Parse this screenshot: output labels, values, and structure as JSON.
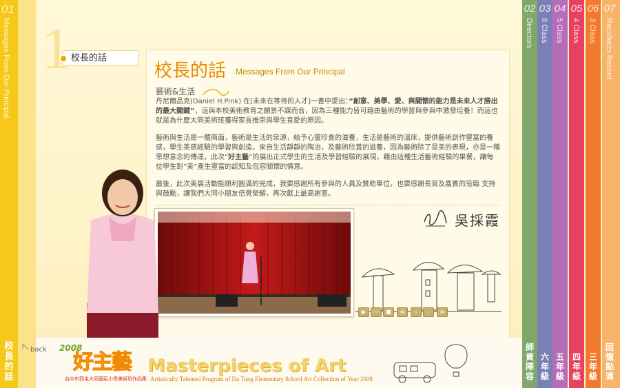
{
  "left_tab": {
    "number": "01",
    "english": "Messages From Our Principal",
    "chinese": "校長的話"
  },
  "page_marker": "1",
  "section_tab": "校長的話",
  "header": {
    "title_cn": "校長的話",
    "title_en": "Messages From Our Principal"
  },
  "subheading": "藝術&生活",
  "paragraphs": [
    {
      "pre": "丹尼爾品克(Daniel H.Pink) 在[未來在等待的人才]一書中提出：",
      "bold": "”創意、美學、愛、與關懷的能力是未來人才勝出的最大關鍵”",
      "post": "，這與本校美術教育之願景不謀而合，因為三種能力皆可藉由藝術的學習與參與中激發培養！而這也就是為什麼大同美術班獲得家長推崇與學生喜愛的原因。"
    },
    {
      "pre": "藝術與生活是一體兩面，藝術是生活的泉源，給予心靈珍貴的滋養，生活是藝術的溫床，提供藝術創作豐富的養感，學生美感經驗的學習與創造，來自生活靜靜的陶冶，及藝術欣賞的滋養，因為藝術除了是美的表現，亦是一種思想意念的傳達，此次”",
      "bold": "好主藝",
      "post": "”的展出正式學生的生活及學習經驗的展現，藉由這種生活藝術經驗的果餐，讓每位學生對”美”產生豐富的認知及包容關懷的情意。"
    },
    {
      "pre": "最後，此次美展活動能順利圓滿的完成，我要感謝所有參與的人員及贊助單位，也要感謝長官及嘉賓的蒞臨 支持與鼓勵，讓我們大同小朋友倍覺榮耀，再次獻上最高謝意。",
      "bold": "",
      "post": ""
    }
  ],
  "signature": "吳採霞",
  "controls": [
    "▶",
    "—",
    "■",
    "≪",
    "‹",
    "›",
    "≫"
  ],
  "right_tabs": [
    {
      "number": "02",
      "english": "Directors",
      "chinese": "師資陣容",
      "color": "#7fa86a"
    },
    {
      "number": "03",
      "english": "6 Class",
      "chinese": "六年級",
      "color": "#7b7fb8"
    },
    {
      "number": "04",
      "english": "5 Class",
      "chinese": "五年級",
      "color": "#b76cb8"
    },
    {
      "number": "05",
      "english": "4 Class",
      "chinese": "四年級",
      "color": "#e84060"
    },
    {
      "number": "06",
      "english": "3 Class",
      "chinese": "三年級",
      "color": "#f27a2c"
    },
    {
      "number": "07",
      "english": "Recollects Record",
      "chinese": "回憶點滴",
      "color": "#f8b46a"
    }
  ],
  "bottom": {
    "back": "back",
    "year": "2008",
    "logo": "好主藝",
    "logo_sub": "台中市西屯大同國民小學美術班作品集",
    "masthead": "Masterpieces of Art",
    "masthead_sub": "Artistically Talented Program of Da Tung Elementary School Art Collection of Year 2008"
  }
}
